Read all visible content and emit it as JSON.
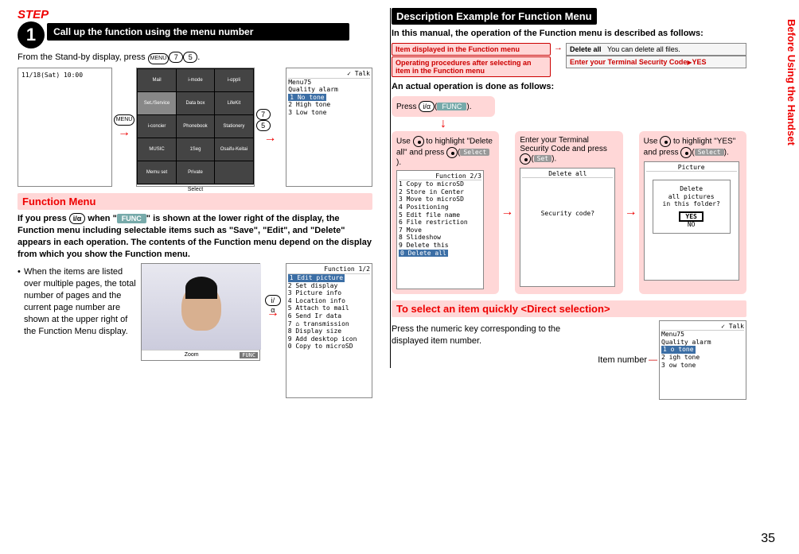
{
  "left": {
    "step_label": "STEP",
    "step_num": "1",
    "step_title": "Call up the function using the menu number",
    "standby_text": "From the Stand-by display, press ",
    "standby_key_menu": "MENU",
    "standby_key_7": "7",
    "standby_key_5": "5",
    "standby_period": ".",
    "screen1_datetime": "11/18(Sat) 10:00",
    "icon_grid": [
      "Mail",
      "i-mode",
      "i-αppli",
      "Set./Service",
      "Data box",
      "LifeKit",
      "i-concier",
      "Phonebook",
      "Stationery",
      "MUSIC",
      "1Seg",
      "Osaifu-Keitai",
      "Memu set",
      "Private",
      ""
    ],
    "screen2_softkey": "Select",
    "menu_key_label_arrow": "MENU",
    "keys75_7": "7",
    "keys75_5": "5",
    "screen3_header_icon": "✓",
    "screen3_title": "Talk",
    "screen3_menu": "Menu75",
    "screen3_sub": "Quality alarm",
    "screen3_item1": "1 No tone",
    "screen3_item2": "2 High tone",
    "screen3_item3": "3 Low tone",
    "func_menu_heading": "Function Menu",
    "func_para_1a": "If you press ",
    "func_para_key": "i/α",
    "func_para_1b": " when \"",
    "func_pill": "FUNC",
    "func_para_1c": "\" is shown at the lower right of the display, the Function menu including selectable items such as \"Save\", \"Edit\", and \"Delete\" appears in each operation. The contents of the Function menu depend on the display from which you show the Function menu.",
    "bullet1": "When the items are listed over multiple pages, the total number of pages and the current page number are shown at the upper right of the Function Menu display.",
    "photo_softkey": "Zoom",
    "photo_softkey_r": "FUNC",
    "func_key_arrow": "i/α",
    "func_screen_title": "Function   1/2",
    "func_items": [
      "1 Edit picture",
      "2 Set display",
      "3 Picture info",
      "4 Location info",
      "5 Attach to mail",
      "6 Send Ir data",
      "7 ⌂ transmission",
      "8 Display size",
      "9 Add desktop icon",
      "0 Copy to microSD"
    ]
  },
  "right": {
    "desc_heading": "Description Example for Function Menu",
    "desc_para": "In this manual, the operation of the Function menu is described as follows:",
    "callout1": "Item displayed in the Function menu",
    "callout2": "Operating procedures after selecting an item in the Function menu",
    "target_label": "Delete all",
    "target_desc": "You can delete all files.",
    "target_sub": "Enter your Terminal Security Code",
    "target_yes": "YES",
    "actual_para": "An actual operation is done as follows:",
    "block0_a": "Press ",
    "block0_key": "i/α",
    "block0_pill": "FUNC",
    "block0_b": ".",
    "block1_a": "Use ",
    "block1_b": " to highlight \"Delete all\" and press ",
    "block1_pill": "Select",
    "block1_c": ".",
    "block2_a": "Enter your Terminal Security Code and press ",
    "block2_pill": "Set",
    "block2_b": ".",
    "block3_a": "Use ",
    "block3_b": " to highlight \"YES\" and press ",
    "block3_pill": "Select",
    "block3_c": ".",
    "fs1_title": "Function   2/3",
    "fs1_items": [
      "1 Copy to microSD",
      "2 Store in Center",
      "3 Move to microSD",
      "4 Positioning",
      "5 Edit file name",
      "6 File restriction",
      "7 Move",
      "8 Slideshow",
      "9 Delete this",
      "0 Delete all"
    ],
    "fs2_title": "Delete all",
    "fs2_text": "Security code?",
    "fs3_title": "Picture",
    "fs3_line1": "Delete",
    "fs3_line2": "all pictures",
    "fs3_line3": "in this folder?",
    "fs3_yes": "YES",
    "fs3_no": "NO",
    "direct_heading": "To select an item quickly <Direct selection>",
    "direct_para": "Press the numeric key corresponding to the displayed item number.",
    "item_number_label": "Item number",
    "ds_icon": "✓",
    "ds_title": "Talk",
    "ds_menu": "Menu75",
    "ds_sub": "Quality alarm",
    "ds_item1": "1 o tone",
    "ds_item2": "2 igh tone",
    "ds_item3": "3 ow tone"
  },
  "side_tab": "Before Using the Handset",
  "page_number": "35"
}
